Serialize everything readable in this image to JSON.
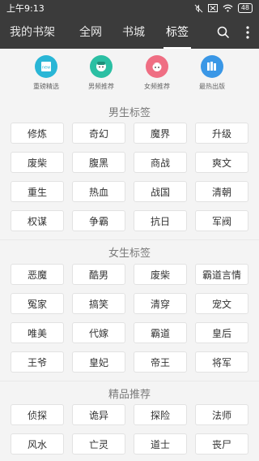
{
  "status": {
    "time": "上午9:13",
    "battery": "48"
  },
  "nav": {
    "tabs": [
      {
        "label": "我的书架"
      },
      {
        "label": "全网"
      },
      {
        "label": "书城"
      },
      {
        "label": "标签"
      }
    ],
    "active_tab": "标签"
  },
  "quick_links": [
    {
      "label": "重磅精选",
      "icon": "new-book-icon",
      "color": "#29b6d6"
    },
    {
      "label": "男频推荐",
      "icon": "boy-face-icon",
      "color": "#2bbfa3"
    },
    {
      "label": "女频推荐",
      "icon": "girl-face-icon",
      "color": "#ef6e83"
    },
    {
      "label": "最热出版",
      "icon": "books-icon",
      "color": "#3a97e6"
    }
  ],
  "sections": [
    {
      "title": "男生标签",
      "tags": [
        "修炼",
        "奇幻",
        "魔界",
        "升级",
        "废柴",
        "腹黑",
        "商战",
        "爽文",
        "重生",
        "热血",
        "战国",
        "清朝",
        "权谋",
        "争霸",
        "抗日",
        "军阀"
      ]
    },
    {
      "title": "女生标签",
      "tags": [
        "恶魔",
        "酷男",
        "废柴",
        "霸道言情",
        "冤家",
        "搞笑",
        "清穿",
        "宠文",
        "唯美",
        "代嫁",
        "霸道",
        "皇后",
        "王爷",
        "皇妃",
        "帝王",
        "将军"
      ]
    },
    {
      "title": "精品推荐",
      "tags": [
        "侦探",
        "诡异",
        "探险",
        "法师",
        "风水",
        "亡灵",
        "道士",
        "丧尸"
      ]
    }
  ],
  "colors": {
    "topbar": "#3b3b3b",
    "background": "#f4f4f4"
  }
}
